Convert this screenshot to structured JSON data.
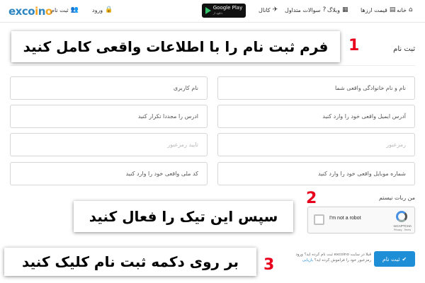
{
  "nav": {
    "logo": {
      "part1": "ex",
      "part2": "co",
      "part3": "i",
      "part4": "n",
      "part5": "o"
    },
    "items": [
      {
        "label": "خانه",
        "icon": "home-icon",
        "glyph": "⌂"
      },
      {
        "label": "قیمت ارزها",
        "icon": "price-icon",
        "glyph": "▤"
      },
      {
        "label": "وبلاگ",
        "icon": "blog-icon",
        "glyph": "▦"
      },
      {
        "label": "سوالات متداول",
        "icon": "question-icon",
        "glyph": "?"
      },
      {
        "label": "کانال",
        "icon": "channel-icon",
        "glyph": "✈"
      }
    ],
    "google_play": {
      "small": "دانلود از",
      "label": "Google Play"
    },
    "login": {
      "label": "ورود",
      "icon": "lock-icon",
      "glyph": "🔒"
    },
    "register": {
      "label": "ثبت نام",
      "icon": "user-add-icon",
      "glyph": "👥"
    }
  },
  "annotations": {
    "step1": {
      "number": "1",
      "text": "فرم ثبت نام را با اطلاعات واقعی کامل کنید"
    },
    "step2": {
      "number": "2",
      "text": "سپس این تیک را فعال کنید"
    },
    "step3": {
      "number": "3",
      "text": "بر روی دکمه ثبت نام کلیک کنید"
    }
  },
  "form": {
    "title": "ثبت نام",
    "fields": {
      "full_name": "نام و نام خانوادگی واقعی شما",
      "username": "نام کاربری",
      "email": "آدرس ایمیل واقعی خود را وارد کنید",
      "email_repeat": "ادرس را مجددا تکرار کنید",
      "password": "رمزعبور",
      "password_confirm": "تایید رمزعبور",
      "mobile": "شماره موبایل واقعی خود را وارد کنید",
      "national_id": "کد ملی واقعی خود را وارد کنید"
    },
    "robot_label": "من ربات نیستم",
    "captcha": {
      "label": "I'm not a robot",
      "brand": "reCAPTCHA",
      "links": "Privacy - Terms"
    },
    "submit_label": "ثبت نام",
    "help": {
      "line1": "قبلا در سایت excoino ثبت نام کرده اید؟ ورود",
      "line2": "رمزعبور خود را فراموش کرده اید؟",
      "link": "بازیابی"
    }
  },
  "colors": {
    "accent": "#1e8fd6",
    "annotation_number": "#e8001c"
  }
}
